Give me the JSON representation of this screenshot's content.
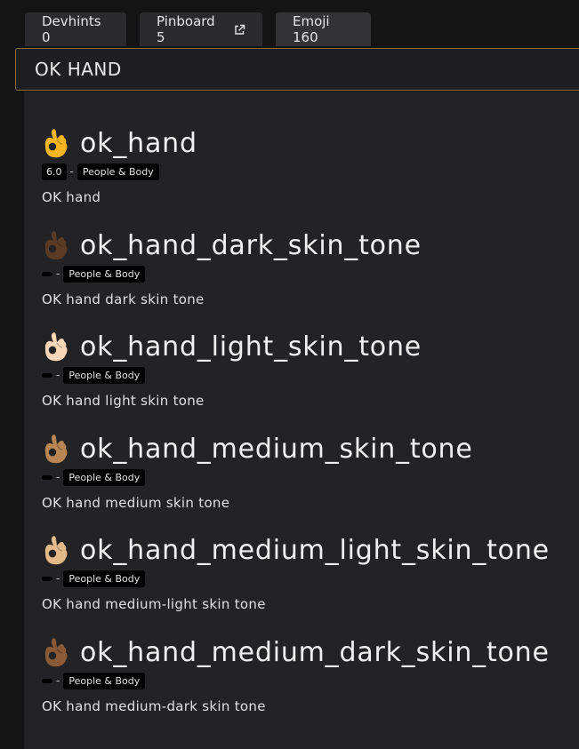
{
  "tabs": [
    {
      "label": "Devhints 0"
    },
    {
      "label": "Pinboard 5"
    },
    {
      "label": "Emoji 160"
    }
  ],
  "search": {
    "value": "OK HAND"
  },
  "results": [
    {
      "name": "ok_hand",
      "version": "6.0",
      "category": "People & Body",
      "description": "OK hand",
      "skin_color": "#f5b621"
    },
    {
      "name": "ok_hand_dark_skin_tone",
      "version": "",
      "category": "People & Body",
      "description": "OK hand dark skin tone",
      "skin_color": "#5b3a24"
    },
    {
      "name": "ok_hand_light_skin_tone",
      "version": "",
      "category": "People & Body",
      "description": "OK hand light skin tone",
      "skin_color": "#f7d7b8"
    },
    {
      "name": "ok_hand_medium_skin_tone",
      "version": "",
      "category": "People & Body",
      "description": "OK hand medium skin tone",
      "skin_color": "#b98552"
    },
    {
      "name": "ok_hand_medium_light_skin_tone",
      "version": "",
      "category": "People & Body",
      "description": "OK hand medium-light skin tone",
      "skin_color": "#e3b98a"
    },
    {
      "name": "ok_hand_medium_dark_skin_tone",
      "version": "",
      "category": "People & Body",
      "description": "OK hand medium-dark skin tone",
      "skin_color": "#8a5a36"
    }
  ],
  "icons": {
    "external_link": "external-link-icon",
    "emoji": "ok-hand-emoji-icon"
  },
  "colors": {
    "search_border": "#8a6a3a",
    "panel": "#232325",
    "badge": "#000000"
  }
}
